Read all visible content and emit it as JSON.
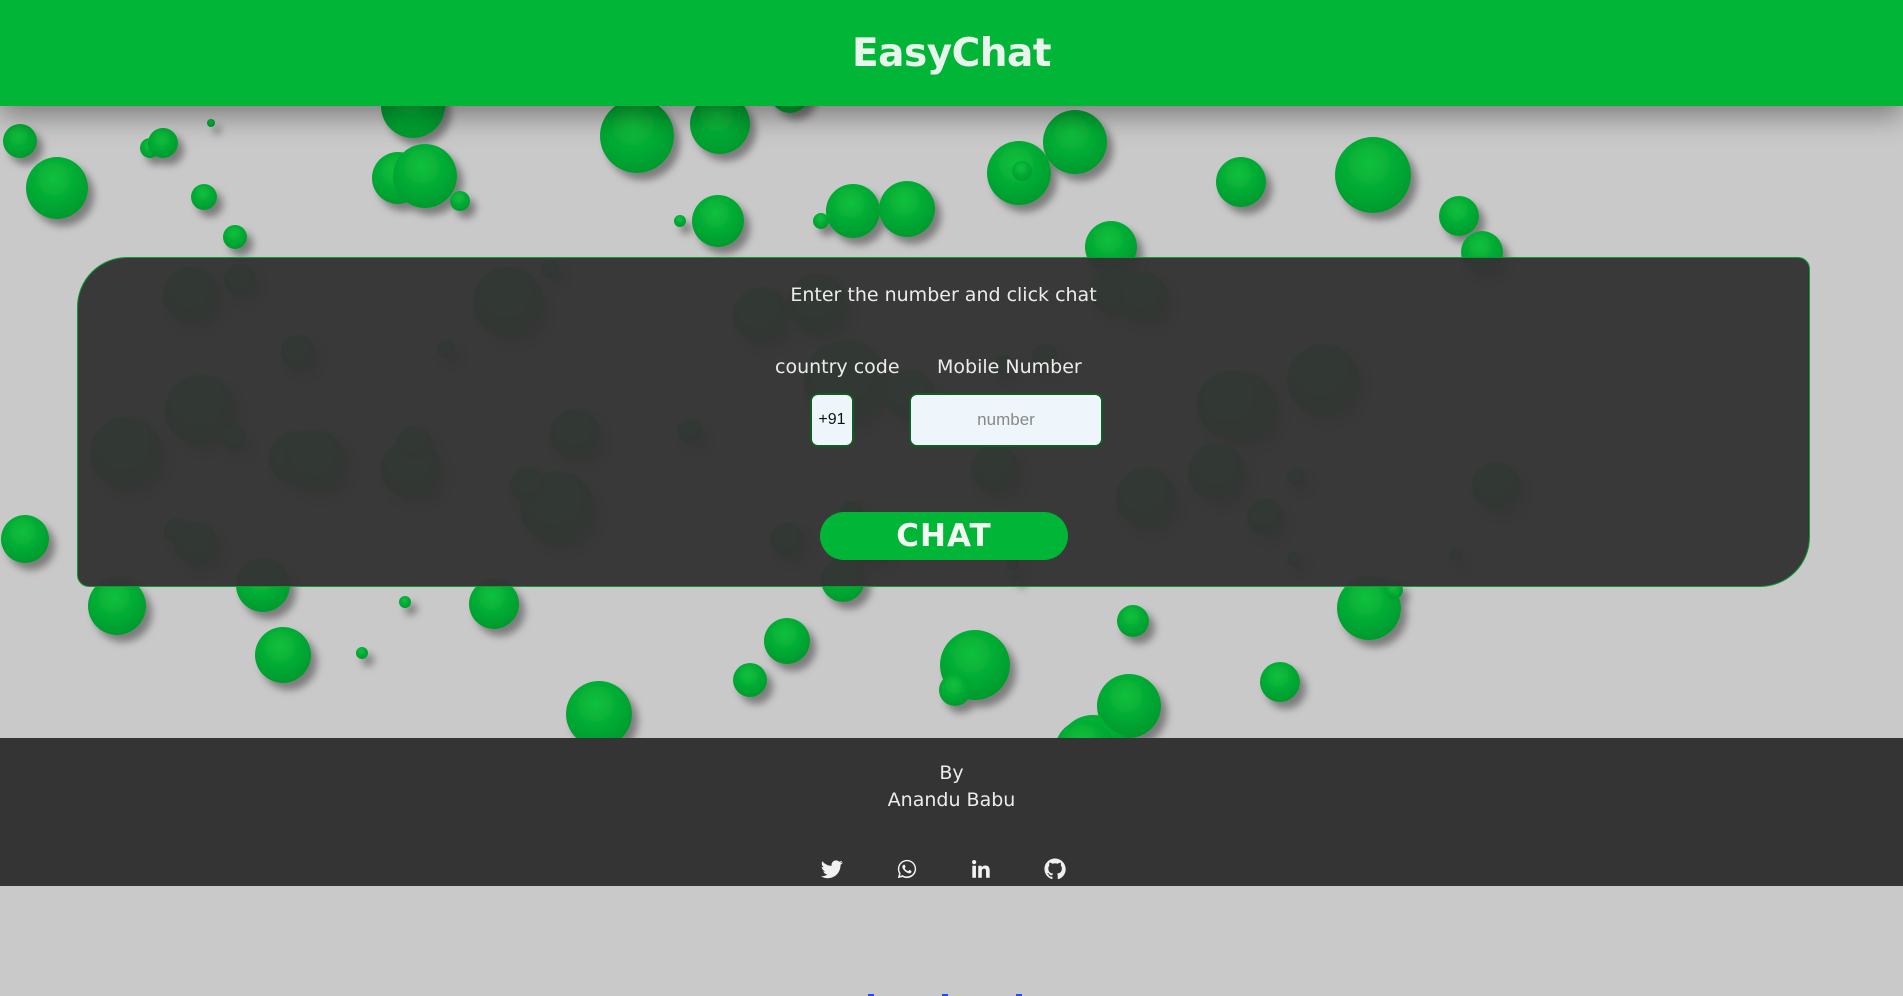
{
  "header": {
    "title": "EasyChat"
  },
  "form": {
    "instruction": "Enter the number and click chat",
    "country_code_label": "country code",
    "country_code_value": "+91",
    "mobile_label": "Mobile Number",
    "mobile_placeholder": "number",
    "mobile_value": "",
    "chat_button": "CHAT"
  },
  "footer": {
    "by": "By",
    "author": "Anandu Babu",
    "social": [
      {
        "icon": "twitter-icon"
      },
      {
        "icon": "whatsapp-icon"
      },
      {
        "icon": "linkedin-icon"
      },
      {
        "icon": "github-icon"
      }
    ]
  },
  "colors": {
    "accent": "#01b636",
    "panel": "#343434",
    "background": "#c9c9c9",
    "footer": "#343434"
  }
}
